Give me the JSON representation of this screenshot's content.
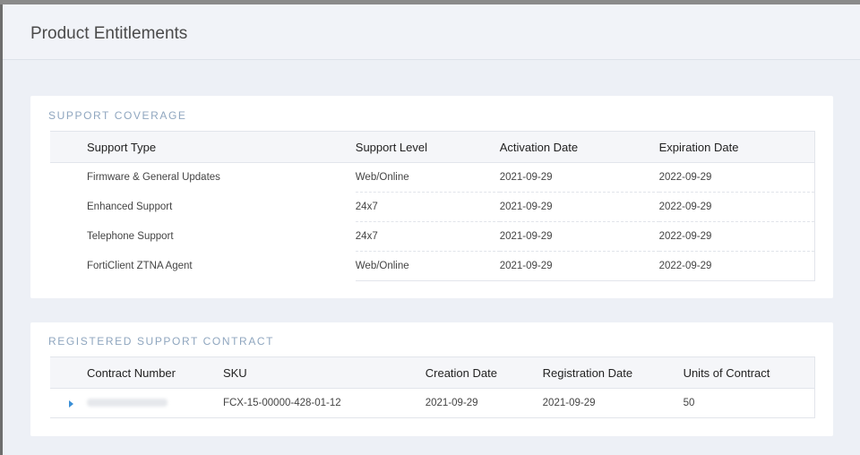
{
  "dialog": {
    "title": "Product Entitlements"
  },
  "support_coverage": {
    "title": "SUPPORT COVERAGE",
    "columns": [
      "Support Type",
      "Support Level",
      "Activation Date",
      "Expiration Date"
    ],
    "rows": [
      [
        "Firmware & General Updates",
        "Web/Online",
        "2021-09-29",
        "2022-09-29"
      ],
      [
        "Enhanced Support",
        "24x7",
        "2021-09-29",
        "2022-09-29"
      ],
      [
        "Telephone Support",
        "24x7",
        "2021-09-29",
        "2022-09-29"
      ],
      [
        "FortiClient ZTNA Agent",
        "Web/Online",
        "2021-09-29",
        "2022-09-29"
      ]
    ]
  },
  "registered_contract": {
    "title": "REGISTERED SUPPORT CONTRACT",
    "columns": [
      "Contract Number",
      "SKU",
      "Creation Date",
      "Registration Date",
      "Units of Contract"
    ],
    "rows": [
      [
        "",
        "FCX-15-00000-428-01-12",
        "2021-09-29",
        "2021-09-29",
        "50"
      ]
    ]
  },
  "colors": {
    "accent": "#3a8fd6",
    "section_title": "#8fa6bf"
  }
}
